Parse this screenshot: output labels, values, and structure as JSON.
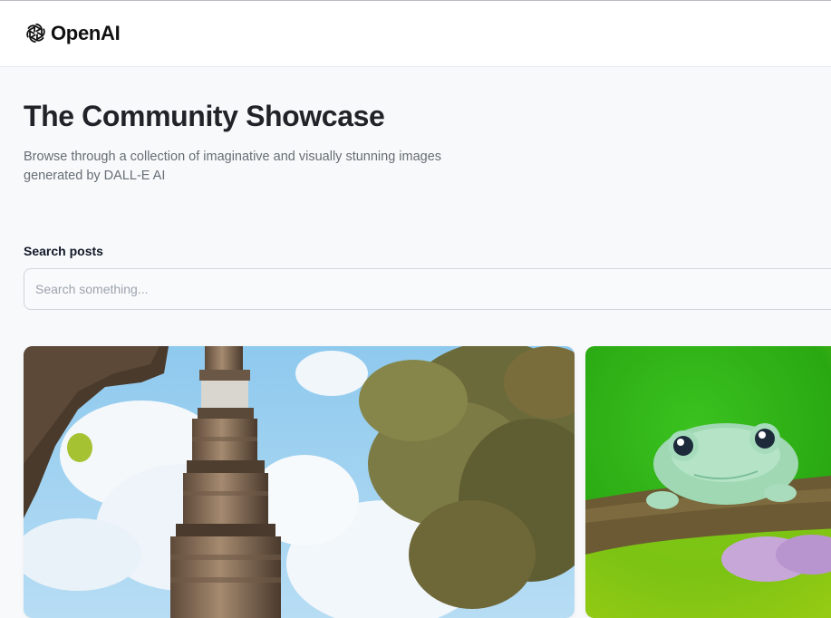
{
  "header": {
    "logo_text": "OpenAI",
    "logo_icon": "openai-logo-icon"
  },
  "hero": {
    "title": "The Community Showcase",
    "subtitle": "Browse through a collection of imaginative and visually stunning images generated by DALL-E AI"
  },
  "search": {
    "label": "Search posts",
    "placeholder": "Search something...",
    "value": ""
  },
  "gallery": {
    "cards": [
      {
        "image": "minaret-tower-and-tree-image"
      },
      {
        "image": "green-frog-on-branch-image"
      }
    ]
  },
  "colors": {
    "page_bg": "#f8f9fb",
    "header_bg": "#ffffff",
    "title": "#222328",
    "subtitle": "#666e75",
    "input_border": "#d1d5db"
  }
}
